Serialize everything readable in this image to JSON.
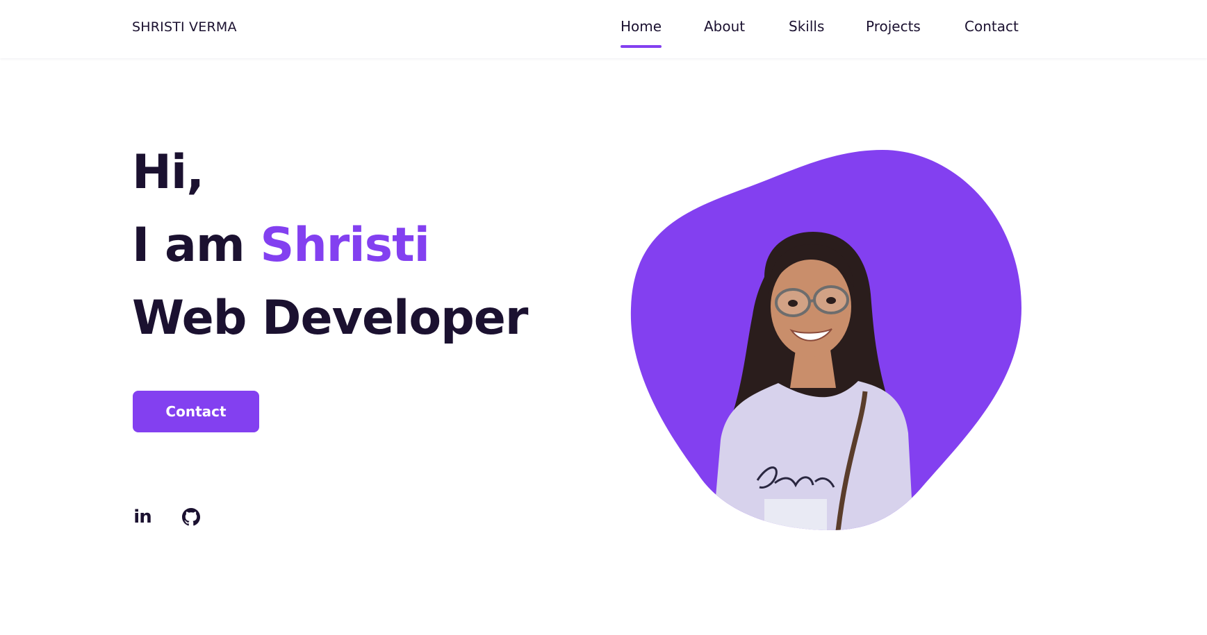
{
  "header": {
    "logo": "SHRISTI VERMA",
    "nav": [
      {
        "label": "Home",
        "active": true
      },
      {
        "label": "About",
        "active": false
      },
      {
        "label": "Skills",
        "active": false
      },
      {
        "label": "Projects",
        "active": false
      },
      {
        "label": "Contact",
        "active": false
      }
    ]
  },
  "hero": {
    "greeting": "Hi,",
    "intro_prefix": "I am ",
    "name": "Shristi",
    "role": "Web Developer",
    "contact_button": "Contact",
    "social": [
      {
        "icon": "linkedin-icon",
        "label": "in"
      },
      {
        "icon": "github-icon"
      }
    ]
  },
  "colors": {
    "accent": "#8340f0",
    "text": "#1b1130",
    "background": "#ffffff"
  }
}
